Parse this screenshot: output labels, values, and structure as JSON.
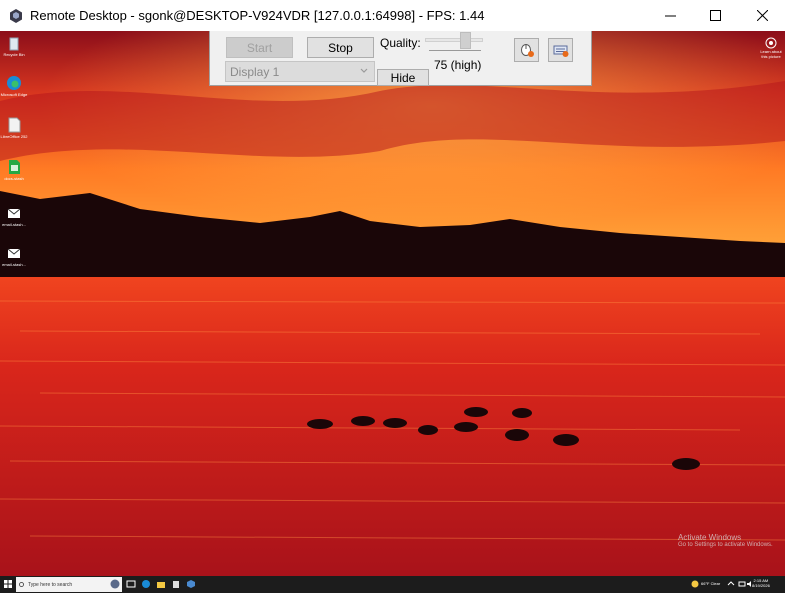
{
  "window": {
    "title": "Remote Desktop - sgonk@DESKTOP-V924VDR [127.0.0.1:64998] - FPS: 1.44"
  },
  "toolbar": {
    "start_label": "Start",
    "stop_label": "Stop",
    "display_selected": "Display 1",
    "hide_label": "Hide",
    "quality_label": "Quality:",
    "quality_value": "75 (high)",
    "quality_level_percent": 75
  },
  "desktop": {
    "icons": [
      {
        "label": "Recycle Bin",
        "icon": "recycle-bin-icon"
      },
      {
        "label": "Microsoft Edge",
        "icon": "edge-icon"
      },
      {
        "label": "LibreOffice 252",
        "icon": "libreoffice-icon"
      },
      {
        "label": "docs-stash",
        "icon": "spreadsheet-icon"
      },
      {
        "label": "email-stash...",
        "icon": "mail-icon"
      },
      {
        "label": "email-stash...",
        "icon": "mail-icon"
      }
    ],
    "learn_label": "Learn about this picture",
    "watermark_line1": "Activate Windows",
    "watermark_line2": "Go to Settings to activate Windows."
  },
  "taskbar": {
    "search_placeholder": "Type here to search",
    "weather": "66°F Clear",
    "clock_time": "2:15 AM",
    "clock_date": "8/19/2026"
  },
  "colors": {
    "sky_top": "#a3141c",
    "sky_glow": "#ff7a24",
    "water": "#d3231c",
    "mountains": "#1a0608",
    "taskbar": "#1c1c1c"
  }
}
